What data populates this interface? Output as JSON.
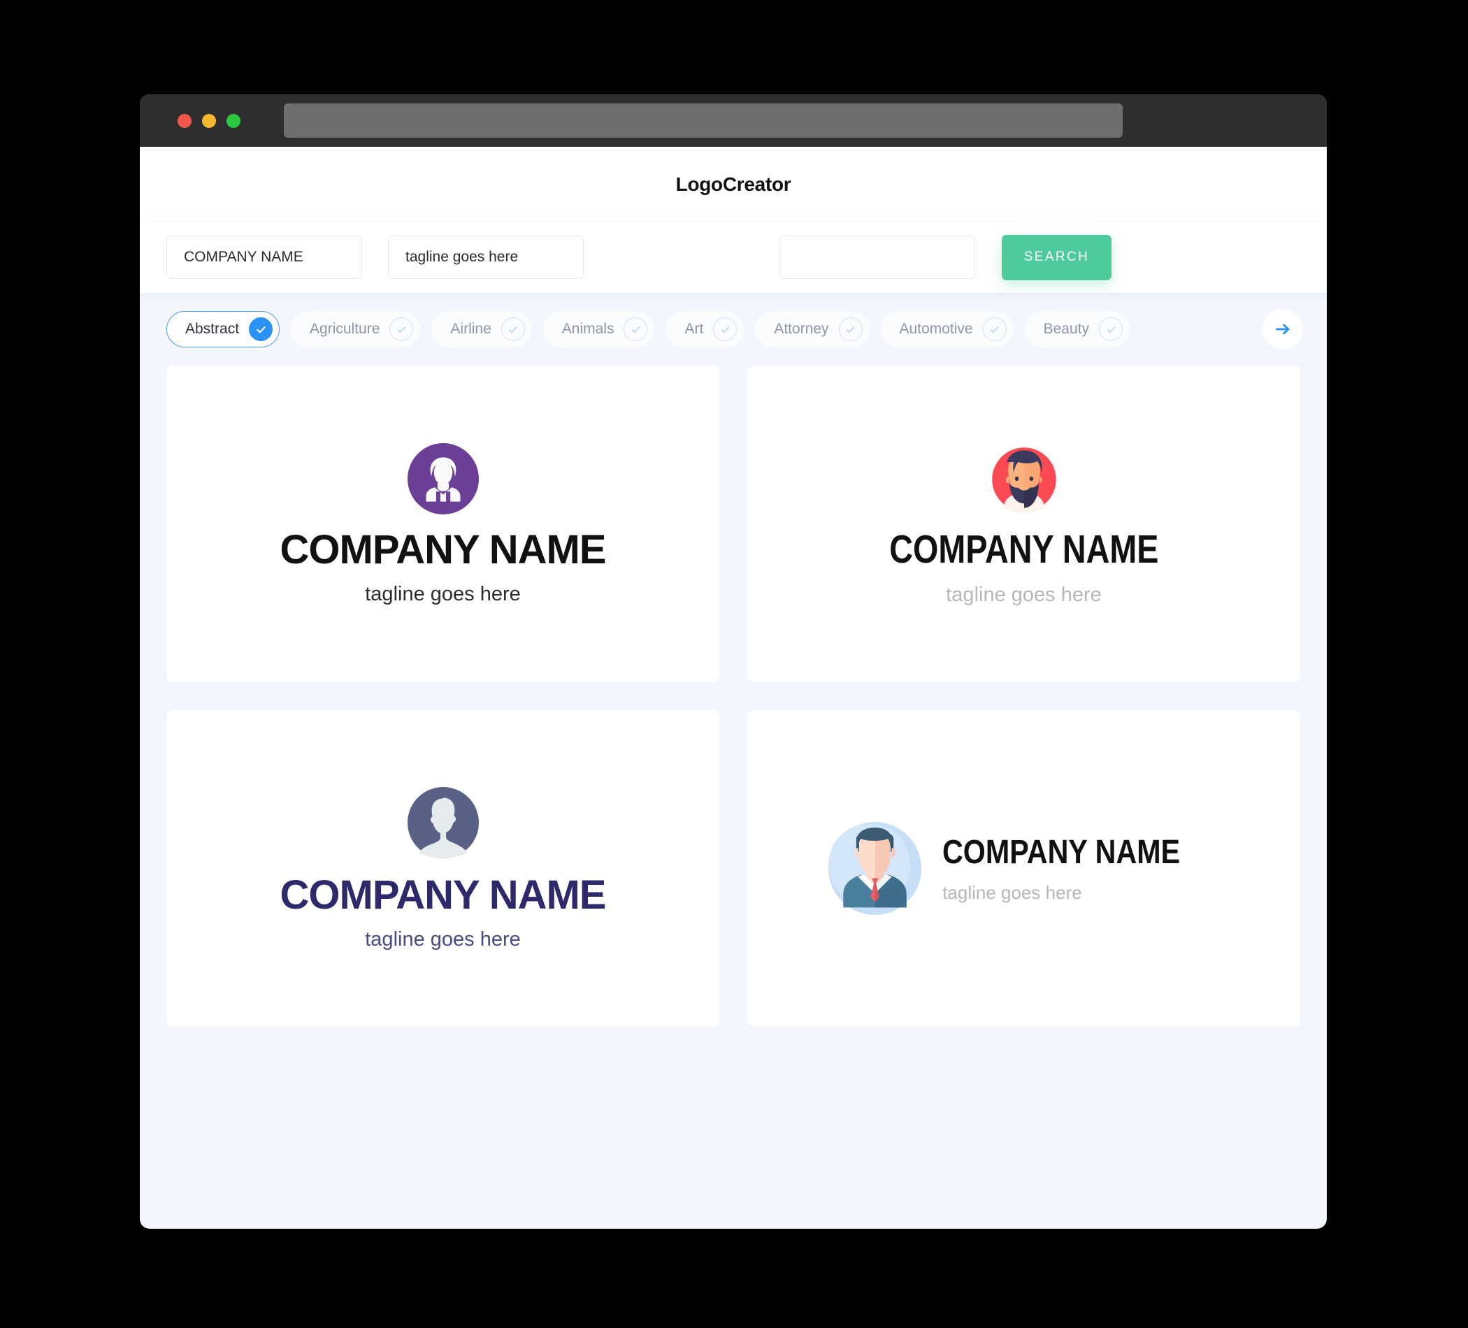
{
  "window": {
    "traffic_lights": [
      "close",
      "minimize",
      "maximize"
    ],
    "url_bar_value": ""
  },
  "header": {
    "app_title": "LogoCreator"
  },
  "search": {
    "company_name_value": "COMPANY NAME",
    "company_name_placeholder": "COMPANY NAME",
    "tagline_value": "tagline goes here",
    "tagline_placeholder": "tagline goes here",
    "keyword_value": "",
    "keyword_placeholder": "",
    "search_button_label": "SEARCH"
  },
  "categories": {
    "next_icon": "arrow-right-icon",
    "items": [
      {
        "label": "Abstract",
        "selected": true
      },
      {
        "label": "Agriculture",
        "selected": false
      },
      {
        "label": "Airline",
        "selected": false
      },
      {
        "label": "Animals",
        "selected": false
      },
      {
        "label": "Art",
        "selected": false
      },
      {
        "label": "Attorney",
        "selected": false
      },
      {
        "label": "Automotive",
        "selected": false
      },
      {
        "label": "Beauty",
        "selected": false
      }
    ]
  },
  "logos": [
    {
      "name": "COMPANY NAME",
      "tagline": "tagline goes here",
      "icon": "person-suit-circle-icon",
      "layout": "stacked",
      "accent": "#6b3f96"
    },
    {
      "name": "COMPANY NAME",
      "tagline": "tagline goes here",
      "icon": "bearded-man-avatar-icon",
      "layout": "stacked",
      "accent": "#f8454f"
    },
    {
      "name": "COMPANY NAME",
      "tagline": "tagline goes here",
      "icon": "silhouette-avatar-icon",
      "layout": "stacked",
      "accent": "#5a6186"
    },
    {
      "name": "COMPANY NAME",
      "tagline": "tagline goes here",
      "icon": "businessman-avatar-icon",
      "layout": "horizontal",
      "accent": "#c3ddf5"
    }
  ],
  "colors": {
    "page_background": "#f3f6fd",
    "search_button": "#4ecb9b",
    "selected_pill": "#2a92f5",
    "card_background": "#ffffff"
  }
}
